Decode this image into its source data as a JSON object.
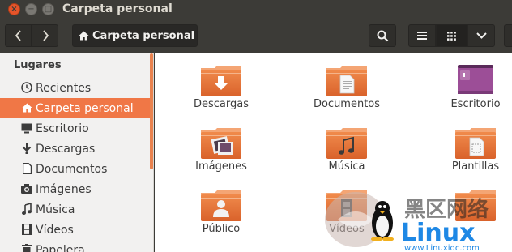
{
  "window": {
    "title": "Carpeta personal",
    "close_glyph": "×",
    "min_glyph": "−",
    "max_glyph": "□"
  },
  "toolbar": {
    "back_icon": "chevron-left-icon",
    "forward_icon": "chevron-right-icon",
    "path_label": "Carpeta personal",
    "path_icon": "home-icon",
    "search_icon": "search-icon",
    "list_view_icon": "list-view-icon",
    "grid_view_icon": "grid-view-icon",
    "view_menu_icon": "chevron-down-icon"
  },
  "sidebar": {
    "header": "Lugares",
    "items": [
      {
        "label": "Recientes",
        "icon": "clock-icon",
        "selected": false
      },
      {
        "label": "Carpeta personal",
        "icon": "home-icon",
        "selected": true
      },
      {
        "label": "Escritorio",
        "icon": "desktop-icon",
        "selected": false
      },
      {
        "label": "Descargas",
        "icon": "download-icon",
        "selected": false
      },
      {
        "label": "Documentos",
        "icon": "document-icon",
        "selected": false
      },
      {
        "label": "Imágenes",
        "icon": "camera-icon",
        "selected": false
      },
      {
        "label": "Música",
        "icon": "music-icon",
        "selected": false
      },
      {
        "label": "Vídeos",
        "icon": "film-icon",
        "selected": false
      },
      {
        "label": "Papelera",
        "icon": "trash-icon",
        "selected": false
      }
    ]
  },
  "files": [
    {
      "name": "Descargas",
      "icon": "download-folder-icon"
    },
    {
      "name": "Documentos",
      "icon": "documents-folder-icon"
    },
    {
      "name": "Escritorio",
      "icon": "desktop-folder-icon"
    },
    {
      "name": "Imágenes",
      "icon": "pictures-folder-icon"
    },
    {
      "name": "Música",
      "icon": "music-folder-icon"
    },
    {
      "name": "Plantillas",
      "icon": "templates-folder-icon"
    },
    {
      "name": "Público",
      "icon": "public-folder-icon"
    },
    {
      "name": "Vídeos",
      "icon": "videos-folder-icon"
    },
    {
      "name": "",
      "icon": "folder-icon"
    }
  ],
  "watermark": {
    "chinese": "黑区网络",
    "brand": "Linux",
    "domain": "www.Linuxidc.com",
    "icon": "tux-penguin-icon"
  },
  "colors": {
    "accent": "#f07746",
    "titlebar": "#3c3b37",
    "sidebar_bg": "#f2f1f0",
    "folder_orange": "#e5763c",
    "folder_tab": "#f4a574"
  }
}
